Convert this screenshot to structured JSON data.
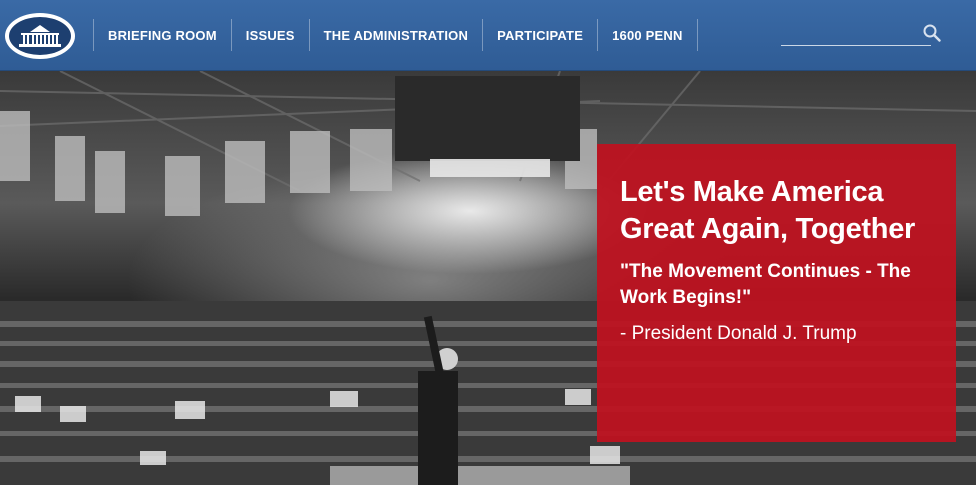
{
  "header": {
    "logo_icon": "white-house-seal-icon",
    "nav": [
      {
        "label": "BRIEFING ROOM"
      },
      {
        "label": "ISSUES"
      },
      {
        "label": "THE ADMINISTRATION"
      },
      {
        "label": "PARTICIPATE"
      },
      {
        "label": "1600 PENN"
      }
    ],
    "search": {
      "placeholder": "",
      "value": "",
      "icon": "search-icon"
    }
  },
  "hero": {
    "image": "rally-crowd-photo",
    "headline": "Let's Make America Great Again, Together",
    "quote": "\"The Movement Continues - The Work Begins!\"",
    "attribution": "- President Donald J. Trump"
  },
  "colors": {
    "header_blue": "#3565a0",
    "quote_red": "#be1220",
    "text_white": "#ffffff"
  }
}
